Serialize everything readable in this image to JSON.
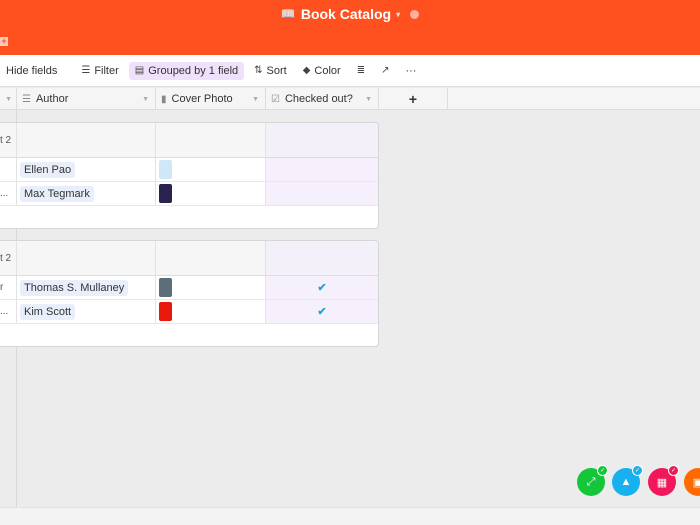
{
  "header": {
    "title": "Book Catalog",
    "book_icon": "book-icon",
    "caret": "▾",
    "add_tab": "+"
  },
  "toolbar": {
    "hide_fields": "Hide fields",
    "filter": "Filter",
    "grouped": "Grouped by 1 field",
    "sort": "Sort",
    "color": "Color",
    "more": "···"
  },
  "columns": {
    "author": "Author",
    "cover_photo": "Cover Photo",
    "checked_out": "Checked out?",
    "add": "+"
  },
  "groups": [
    {
      "label_fragment": "t 2",
      "rows": [
        {
          "first_col_fragment": "",
          "author": "Ellen Pao",
          "cover_color": "#cfe8f7",
          "checked_out": false
        },
        {
          "first_col_fragment": "...",
          "author": "Max Tegmark",
          "cover_color": "#2a2350",
          "checked_out": false
        }
      ]
    },
    {
      "label_fragment": "t 2",
      "rows": [
        {
          "first_col_fragment": "r",
          "author": "Thomas S. Mullaney",
          "cover_color": "#5b6e7a",
          "checked_out": true
        },
        {
          "first_col_fragment": "...",
          "author": "Kim Scott",
          "cover_color": "#e8180c",
          "checked_out": true
        }
      ]
    }
  ],
  "check_glyph": "✔",
  "apps": [
    {
      "name": "green-app",
      "color": "#14c63a"
    },
    {
      "name": "blue-app",
      "color": "#17b1f0"
    },
    {
      "name": "pink-app",
      "color": "#f0185a"
    },
    {
      "name": "orange-app",
      "color": "#ff6a00"
    }
  ]
}
